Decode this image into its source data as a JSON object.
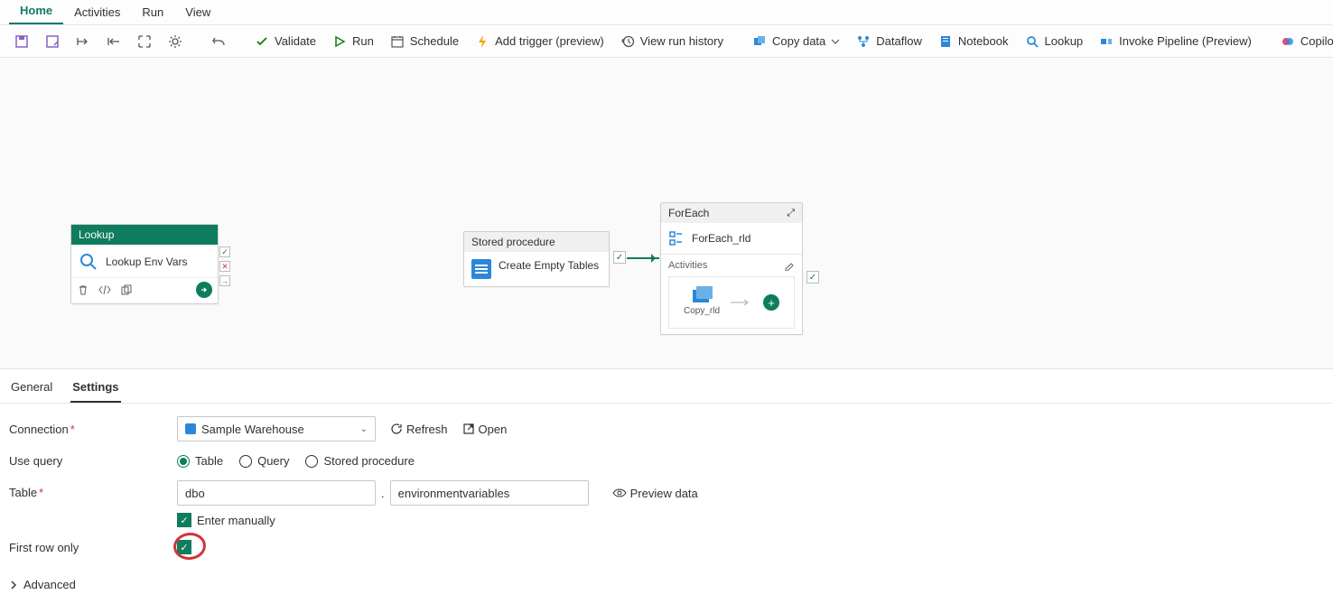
{
  "tabs": {
    "home": "Home",
    "activities": "Activities",
    "run": "Run",
    "view": "View"
  },
  "toolbar": {
    "validate": "Validate",
    "run": "Run",
    "schedule": "Schedule",
    "add_trigger": "Add trigger (preview)",
    "view_run_history": "View run history",
    "copy_data": "Copy data",
    "dataflow": "Dataflow",
    "notebook": "Notebook",
    "lookup": "Lookup",
    "invoke_pipeline": "Invoke Pipeline (Preview)",
    "copilot": "Copilot"
  },
  "canvas": {
    "lookup": {
      "type": "Lookup",
      "name": "Lookup Env Vars"
    },
    "stored_proc": {
      "type": "Stored procedure",
      "name": "Create Empty Tables"
    },
    "foreach": {
      "type": "ForEach",
      "name": "ForEach_rld",
      "activities_label": "Activities",
      "copy_label": "Copy_rld"
    }
  },
  "bottom_tabs": {
    "general": "General",
    "settings": "Settings"
  },
  "form": {
    "connection_label": "Connection",
    "connection_value": "Sample Warehouse",
    "refresh": "Refresh",
    "open": "Open",
    "use_query_label": "Use query",
    "opt_table": "Table",
    "opt_query": "Query",
    "opt_sp": "Stored procedure",
    "table_label": "Table",
    "schema_value": "dbo",
    "table_value": "environmentvariables",
    "preview": "Preview data",
    "enter_manually": "Enter manually",
    "first_row_label": "First row only",
    "advanced": "Advanced"
  }
}
